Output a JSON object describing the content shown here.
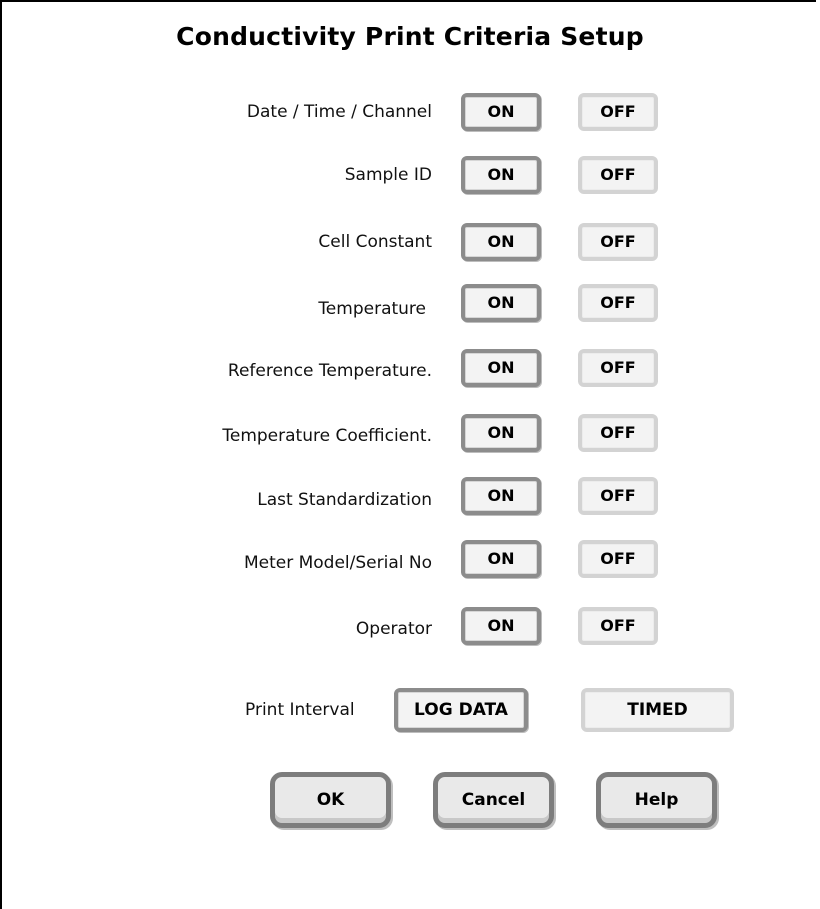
{
  "window": {
    "title": "Conductivity Print Criteria Setup"
  },
  "criteria": [
    {
      "label": "Date / Time / Channel",
      "on": "ON",
      "off": "OFF",
      "selected": "ON"
    },
    {
      "label": "Sample ID",
      "on": "ON",
      "off": "OFF",
      "selected": "ON"
    },
    {
      "label": "Cell Constant",
      "on": "ON",
      "off": "OFF",
      "selected": "ON"
    },
    {
      "label": "Temperature",
      "on": "ON",
      "off": "OFF",
      "selected": "ON"
    },
    {
      "label": "Reference Temperature.",
      "on": "ON",
      "off": "OFF",
      "selected": "ON"
    },
    {
      "label": "Temperature Coefficient.",
      "on": "ON",
      "off": "OFF",
      "selected": "ON"
    },
    {
      "label": "Last Standardization",
      "on": "ON",
      "off": "OFF",
      "selected": "ON"
    },
    {
      "label": "Meter Model/Serial No",
      "on": "ON",
      "off": "OFF",
      "selected": "ON"
    },
    {
      "label": "Operator",
      "on": "ON",
      "off": "OFF",
      "selected": "ON"
    }
  ],
  "print_interval": {
    "label": "Print Interval",
    "log_data": "LOG DATA",
    "timed": "TIMED",
    "selected": "LOG DATA"
  },
  "actions": {
    "ok": "OK",
    "cancel": "Cancel",
    "help": "Help"
  },
  "colors": {
    "selected_border": "#8c8c8c",
    "unselected_border": "#d3d3d3",
    "button_fill": "#f3f3f3"
  }
}
